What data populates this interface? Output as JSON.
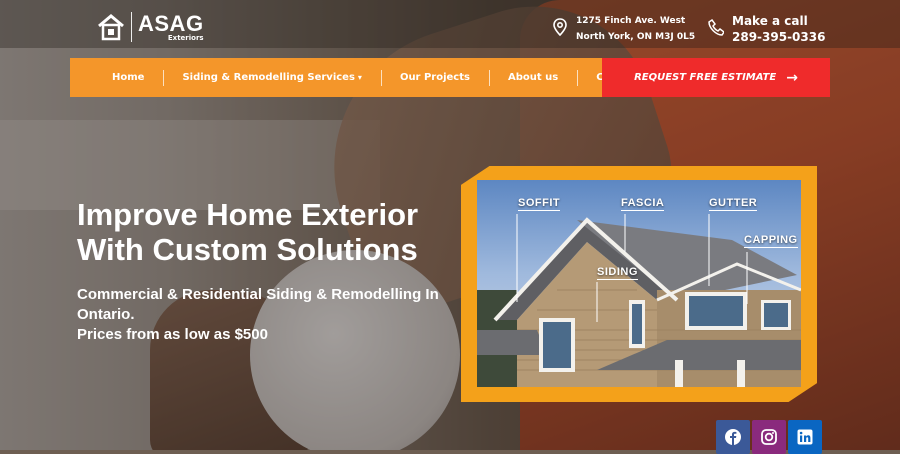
{
  "brand": {
    "name": "ASAG",
    "sub": "Exteriors"
  },
  "contact": {
    "address_line1": "1275 Finch Ave. West",
    "address_line2": "North York, ON M3J 0L5",
    "phone_label": "Make a call",
    "phone_number": "289-395-0336"
  },
  "nav": {
    "items": [
      {
        "label": "Home"
      },
      {
        "label": "Siding & Remodelling Services"
      },
      {
        "label": "Our Projects"
      },
      {
        "label": "About us"
      },
      {
        "label": "Contact us"
      }
    ],
    "cta": "REQUEST FREE ESTIMATE"
  },
  "hero": {
    "headline_line1": "Improve Home Exterior",
    "headline_line2": "With Custom Solutions",
    "sub_line1": "Commercial & Residential Siding & Remodelling In",
    "sub_line2": "Ontario.",
    "sub_line3": "Prices from as low as $500"
  },
  "diagram": {
    "labels": {
      "soffit": "SOFFIT",
      "fascia": "FASCIA",
      "gutter": "GUTTER",
      "capping": "CAPPING",
      "siding": "SIDING"
    }
  },
  "social": [
    {
      "icon": "facebook-icon",
      "color": "#3b5998"
    },
    {
      "icon": "instagram-icon",
      "color": "#8a2a7d"
    },
    {
      "icon": "linkedin-icon",
      "color": "#0a66c2"
    }
  ],
  "colors": {
    "nav": "#f4962a",
    "cta": "#ef2b2b",
    "frame": "#f4a11a"
  }
}
